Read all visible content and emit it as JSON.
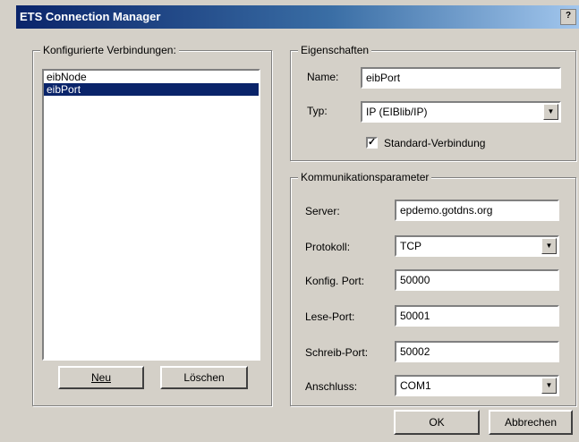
{
  "window": {
    "title": "ETS Connection Manager",
    "title_button": "?"
  },
  "connections": {
    "legend": "Konfigurierte Verbindungen:",
    "items": [
      "eibNode",
      "eibPort"
    ],
    "selected_index": 1,
    "new_label": "Neu",
    "delete_label": "Löschen"
  },
  "properties": {
    "legend": "Eigenschaften",
    "name_label": "Name:",
    "name_value": "eibPort",
    "type_label": "Typ:",
    "type_value": "IP (EIBlib/IP)",
    "default_label": "Standard-Verbindung",
    "default_checked": "✓"
  },
  "comm": {
    "legend": "Kommunikationsparameter",
    "server_label": "Server:",
    "server_value": "epdemo.gotdns.org",
    "protocol_label": "Protokoll:",
    "protocol_value": "TCP",
    "config_port_label": "Konfig. Port:",
    "config_port_value": "50000",
    "read_port_label": "Lese-Port:",
    "read_port_value": "50001",
    "write_port_label": "Schreib-Port:",
    "write_port_value": "50002",
    "connection_label": "Anschluss:",
    "connection_value": "COM1"
  },
  "footer": {
    "ok_label": "OK",
    "cancel_label": "Abbrechen"
  },
  "icons": {
    "combo_arrow": "▼"
  }
}
